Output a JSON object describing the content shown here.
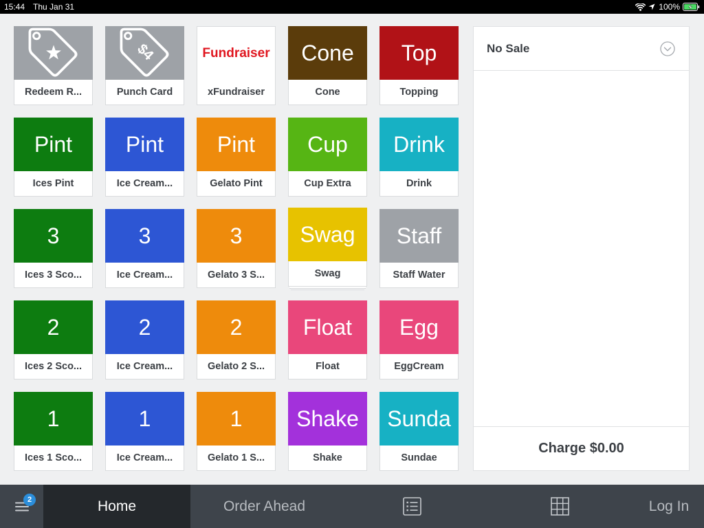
{
  "status_bar": {
    "time": "15:44",
    "date": "Thu Jan 31",
    "battery": "100%",
    "icons": [
      "wifi-icon",
      "location-arrow-icon",
      "battery-charging-icon"
    ]
  },
  "items": [
    {
      "label": "Redeem R...",
      "color": "#9ea2a7",
      "icon": "star-tag-icon"
    },
    {
      "label": "Punch Card",
      "color": "#9ea2a7",
      "icon": "dollar-tag-icon",
      "icon_text": "$4"
    },
    {
      "label": "xFundraiser",
      "tile_text": "Fundraiser",
      "color": "#ffffff",
      "text_color": "#e0161f"
    },
    {
      "label": "Cone",
      "tile_text": "Cone",
      "color": "#5b3c0b"
    },
    {
      "label": "Topping",
      "tile_text": "Top",
      "color": "#b11217"
    },
    {
      "label": "Ices Pint",
      "tile_text": "Pint",
      "color": "#0d7c10"
    },
    {
      "label": "Ice Cream...",
      "tile_text": "Pint",
      "color": "#2d56d4"
    },
    {
      "label": "Gelato Pint",
      "tile_text": "Pint",
      "color": "#ee8b0c"
    },
    {
      "label": "Cup Extra",
      "tile_text": "Cup",
      "color": "#56b514"
    },
    {
      "label": "Drink",
      "tile_text": "Drink",
      "color": "#17b1c4"
    },
    {
      "label": "Ices 3 Sco...",
      "tile_text": "3",
      "color": "#0d7c10"
    },
    {
      "label": "Ice Cream...",
      "tile_text": "3",
      "color": "#2d56d4"
    },
    {
      "label": "Gelato 3 S...",
      "tile_text": "3",
      "color": "#ee8b0c"
    },
    {
      "label": "Swag",
      "tile_text": "Swag",
      "color": "#e7c200",
      "category": true
    },
    {
      "label": "Staff Water",
      "tile_text": "Staff",
      "color": "#9ea2a7"
    },
    {
      "label": "Ices 2 Sco...",
      "tile_text": "2",
      "color": "#0d7c10"
    },
    {
      "label": "Ice Cream...",
      "tile_text": "2",
      "color": "#2d56d4"
    },
    {
      "label": "Gelato 2 S...",
      "tile_text": "2",
      "color": "#ee8b0c"
    },
    {
      "label": "Float",
      "tile_text": "Float",
      "color": "#e9477b"
    },
    {
      "label": "EggCream",
      "tile_text": "Egg",
      "color": "#e9477b"
    },
    {
      "label": "Ices 1 Sco...",
      "tile_text": "1",
      "color": "#0d7c10"
    },
    {
      "label": "Ice Cream...",
      "tile_text": "1",
      "color": "#2d56d4"
    },
    {
      "label": "Gelato 1 S...",
      "tile_text": "1",
      "color": "#ee8b0c"
    },
    {
      "label": "Shake",
      "tile_text": "Shake",
      "color": "#a331db"
    },
    {
      "label": "Sundae",
      "tile_text": "Sunda",
      "color": "#17b1c4"
    }
  ],
  "cart": {
    "title": "No Sale",
    "charge_label": "Charge $0.00",
    "dropdown_icon": "chevron-down-icon"
  },
  "nav": {
    "menu_icon": "hamburger-menu-icon",
    "menu_badge": "2",
    "tabs": [
      {
        "label": "Home",
        "active": true
      },
      {
        "label": "Order Ahead",
        "active": false
      }
    ],
    "icon_buttons": [
      "list-icon",
      "grid-icon"
    ],
    "login_label": "Log In"
  },
  "theme": {
    "status_bar_bg": "#000000",
    "nav_bg": "#3e444b",
    "nav_active_bg": "#24282c",
    "badge": "#2b8edb",
    "battery_fill": "#4cd964"
  }
}
